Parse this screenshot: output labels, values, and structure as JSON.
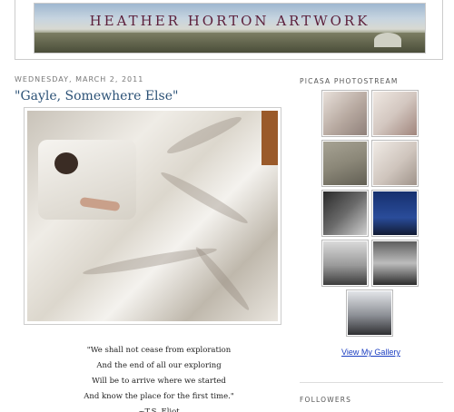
{
  "header": {
    "title": "HEATHER HORTON ARTWORK"
  },
  "post": {
    "date": "WEDNESDAY, MARCH 2, 2011",
    "title": "\"Gayle, Somewhere Else\"",
    "quote_lines": [
      "\"We shall not cease from exploration",
      "And the end of all our exploring",
      "Will be to arrive where we started",
      "And know the place for the first time.\"",
      "~T.S. Eliot"
    ]
  },
  "sidebar": {
    "photostream_heading": "PICASA PHOTOSTREAM",
    "gallery_link": "View My Gallery",
    "followers_heading": "FOLLOWERS",
    "thumbnails": [
      {
        "name": "thumb-self-portrait-1",
        "color": "#b7a9a0"
      },
      {
        "name": "thumb-self-portrait-2",
        "color": "#d3c7c0"
      },
      {
        "name": "thumb-grass-sketch-1",
        "color": "#8b8778"
      },
      {
        "name": "thumb-portrait-sketch",
        "color": "#cfc5bd"
      },
      {
        "name": "thumb-bw-figure",
        "color": "#4d4d4d"
      },
      {
        "name": "thumb-blue-night",
        "color": "#223a7a"
      },
      {
        "name": "thumb-city-skyline",
        "color": "#7c7c7c"
      },
      {
        "name": "thumb-bw-sky",
        "color": "#9a9a9a"
      },
      {
        "name": "thumb-gargoyle",
        "color": "#5f6266"
      }
    ]
  }
}
